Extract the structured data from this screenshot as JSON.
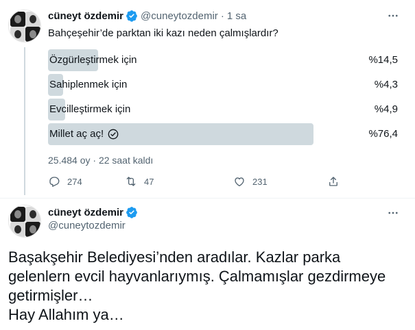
{
  "tweet1": {
    "author_name": "cüneyt özdemir",
    "author_handle": "@cuneytozdemir",
    "separator": "·",
    "time": "1 sa",
    "question": "Bahçeşehir’de parktan iki kazı neden çalmışlardır?",
    "poll": [
      {
        "label": "Özgürleştirmek için",
        "percent_text": "%14,5",
        "percent": 14.5,
        "winner": false
      },
      {
        "label": "Sahiplenmek için",
        "percent_text": "%4,3",
        "percent": 4.3,
        "winner": false
      },
      {
        "label": "Evcilleştirmek için",
        "percent_text": "%4,9",
        "percent": 4.9,
        "winner": false
      },
      {
        "label": "Millet aç aç!",
        "percent_text": "%76,4",
        "percent": 76.4,
        "winner": true
      }
    ],
    "poll_meta": "25.484 oy · 22 saat kaldı",
    "actions": {
      "replies": "274",
      "retweets": "47",
      "likes": "231"
    },
    "icons": [
      "verified-icon",
      "more-icon",
      "checkmark-circle-icon",
      "reply-icon",
      "retweet-icon",
      "like-icon",
      "share-icon"
    ]
  },
  "tweet2": {
    "author_name": "cüneyt özdemir",
    "author_handle": "@cuneytozdemir",
    "body_lines": [
      "Başakşehir Belediyesi’nden aradılar. Kazlar parka",
      "gelenlern evcil hayvanlarıymış. Çalmamışlar gezdirmeye",
      "getirmişler…",
      "Hay Allahım ya…"
    ]
  },
  "colors": {
    "verified": "#1d9bf0",
    "secondary_text": "#536471",
    "poll_bar": "#cfd9de",
    "thread_line": "#cfd9de"
  }
}
